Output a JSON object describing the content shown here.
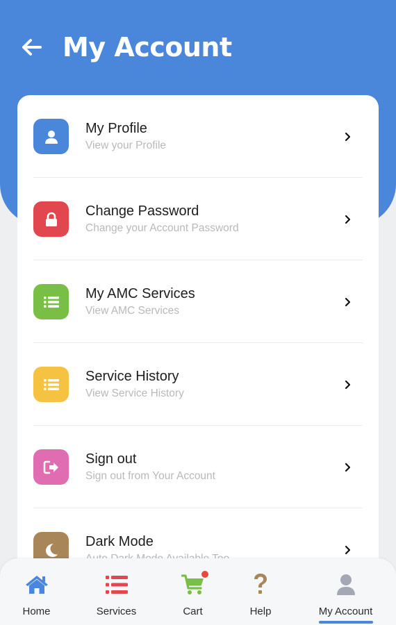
{
  "header": {
    "title": "My Account",
    "back_icon": "arrow-left-icon",
    "background_color": "#4a86d9"
  },
  "menu": {
    "items": [
      {
        "title": "My Profile",
        "subtitle": "View your Profile",
        "icon": "user-icon",
        "color": "#4a86d9"
      },
      {
        "title": "Change Password",
        "subtitle": "Change your Account Password",
        "icon": "lock-icon",
        "color": "#e24750"
      },
      {
        "title": "My AMC Services",
        "subtitle": "View AMC Services",
        "icon": "list-icon",
        "color": "#79bf45"
      },
      {
        "title": "Service History",
        "subtitle": "View Service History",
        "icon": "list-icon",
        "color": "#f6c242"
      },
      {
        "title": "Sign out",
        "subtitle": "Sign out from Your Account",
        "icon": "sign-out-icon",
        "color": "#e06cb1"
      },
      {
        "title": "Dark Mode",
        "subtitle": "Auto Dark Mode Available Too",
        "icon": "moon-icon",
        "color": "#a8865a"
      }
    ]
  },
  "bottom_nav": {
    "items": [
      {
        "label": "Home",
        "icon": "home-icon",
        "color": "#4a86d9"
      },
      {
        "label": "Services",
        "icon": "list-icon",
        "color": "#e24750"
      },
      {
        "label": "Cart",
        "icon": "cart-icon",
        "color": "#79bf45",
        "has_badge": true
      },
      {
        "label": "Help",
        "icon": "question-icon",
        "color": "#a8865a"
      },
      {
        "label": "My Account",
        "icon": "user-icon",
        "color": "#a4a8b4",
        "active": true
      }
    ],
    "active_color": "#4a86d9"
  }
}
